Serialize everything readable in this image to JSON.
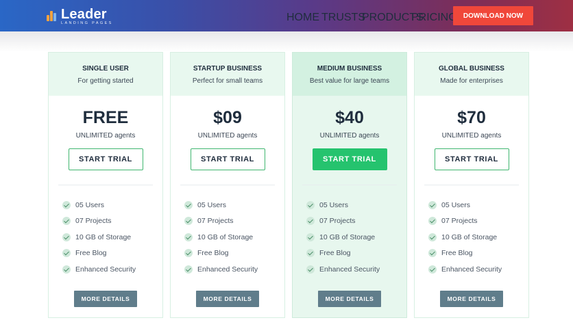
{
  "brand": {
    "name": "Leader",
    "tagline": "LANDING PAGES"
  },
  "nav": {
    "items": [
      "HOME",
      "TRUSTS",
      "PRODUCTS",
      "PRICING"
    ],
    "cta": "DOWNLOAD NOW"
  },
  "colors": {
    "accent": "#25c36e",
    "cta": "#f0473a",
    "button_secondary": "#607d8b"
  },
  "plans": [
    {
      "name": "SINGLE USER",
      "desc": "For getting started",
      "price": "FREE",
      "agents": "UNLIMITED agents",
      "trial": "START TRIAL",
      "features": [
        "05 Users",
        "07 Projects",
        "10 GB of Storage",
        "Free Blog",
        "Enhanced Security"
      ],
      "more": "MORE DETAILS"
    },
    {
      "name": "STARTUP BUSINESS",
      "desc": "Perfect for small teams",
      "price": "$09",
      "agents": "UNLIMITED agents",
      "trial": "START TRIAL",
      "features": [
        "05 Users",
        "07 Projects",
        "10 GB of Storage",
        "Free Blog",
        "Enhanced Security"
      ],
      "more": "MORE DETAILS"
    },
    {
      "name": "MEDIUM BUSINESS",
      "desc": "Best value for large teams",
      "price": "$40",
      "agents": "UNLIMITED agents",
      "trial": "START TRIAL",
      "features": [
        "05 Users",
        "07 Projects",
        "10 GB of Storage",
        "Free Blog",
        "Enhanced Security"
      ],
      "more": "MORE DETAILS"
    },
    {
      "name": "GLOBAL BUSINESS",
      "desc": "Made for enterprises",
      "price": "$70",
      "agents": "UNLIMITED agents",
      "trial": "START TRIAL",
      "features": [
        "05 Users",
        "07 Projects",
        "10 GB of Storage",
        "Free Blog",
        "Enhanced Security"
      ],
      "more": "MORE DETAILS"
    }
  ]
}
